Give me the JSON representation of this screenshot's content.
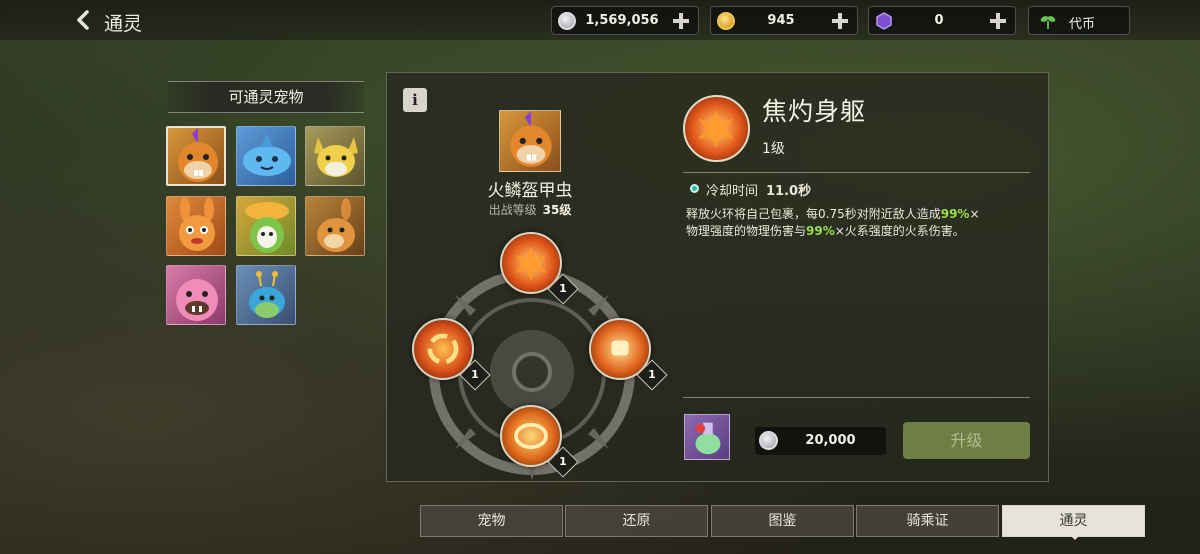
{
  "header": {
    "title": "通灵",
    "currencies": [
      {
        "icon": "silver-coin-icon",
        "amount": "1,569,056",
        "color": "#c7c9cc"
      },
      {
        "icon": "gold-coin-icon",
        "amount": "945",
        "color": "#e6b52e"
      },
      {
        "icon": "purple-gem-icon",
        "amount": "0",
        "color": "#7a4fd0"
      }
    ],
    "token_label": "代币"
  },
  "pet_list": {
    "title": "可通灵宠物",
    "pets": [
      {
        "name": "fire-beetle",
        "selected": true
      },
      {
        "name": "blue-fish"
      },
      {
        "name": "yellow-wolf"
      },
      {
        "name": "orange-rabbit"
      },
      {
        "name": "green-sprout"
      },
      {
        "name": "brown-kangaroo"
      },
      {
        "name": "pink-ogre"
      },
      {
        "name": "blue-snail"
      }
    ]
  },
  "pet": {
    "name": "火鳞盔甲虫",
    "level_label": "出战等级",
    "level": "35级"
  },
  "skills": [
    {
      "slot": "top",
      "level": "1"
    },
    {
      "slot": "left",
      "level": "1"
    },
    {
      "slot": "right",
      "level": "1"
    },
    {
      "slot": "bottom",
      "level": "1"
    }
  ],
  "skill_detail": {
    "name": "焦灼身躯",
    "level": "1级",
    "cooldown_label": "冷却时间",
    "cooldown_value": "11.0秒",
    "desc_1": "释放火环将自己包裹，每0.75秒对附近敌人造成",
    "desc_pct_1": "99%",
    "desc_2": "×",
    "desc_3": "物理强度的物理伤害与",
    "desc_pct_2": "99%",
    "desc_4": "×火系强度的火系伤害。"
  },
  "upgrade": {
    "cost": "20,000",
    "button_label": "升级"
  },
  "tabs": [
    {
      "label": "宠物"
    },
    {
      "label": "还原"
    },
    {
      "label": "图鉴"
    },
    {
      "label": "骑乘证"
    },
    {
      "label": "通灵",
      "active": true
    }
  ],
  "info_glyph": "i"
}
